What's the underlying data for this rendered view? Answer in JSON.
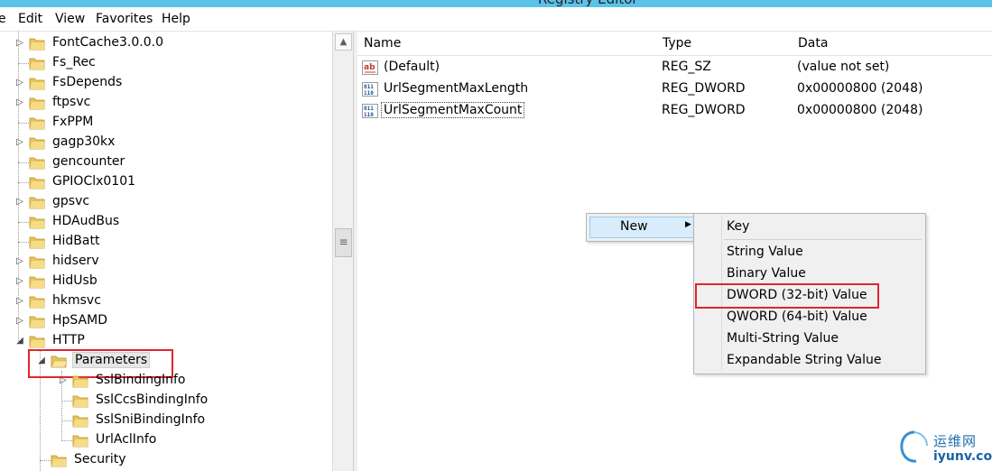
{
  "window": {
    "title": "Registry Editor"
  },
  "menu": [
    "e",
    "Edit",
    "View",
    "Favorites",
    "Help"
  ],
  "tree": {
    "items": [
      {
        "label": "FontCache3.0.0.0",
        "expander": "▷"
      },
      {
        "label": "Fs_Rec",
        "expander": ""
      },
      {
        "label": "FsDepends",
        "expander": "▷"
      },
      {
        "label": "ftpsvc",
        "expander": "▷"
      },
      {
        "label": "FxPPM",
        "expander": ""
      },
      {
        "label": "gagp30kx",
        "expander": "▷"
      },
      {
        "label": "gencounter",
        "expander": ""
      },
      {
        "label": "GPIOClx0101",
        "expander": ""
      },
      {
        "label": "gpsvc",
        "expander": "▷"
      },
      {
        "label": "HDAudBus",
        "expander": ""
      },
      {
        "label": "HidBatt",
        "expander": ""
      },
      {
        "label": "hidserv",
        "expander": "▷"
      },
      {
        "label": "HidUsb",
        "expander": "▷"
      },
      {
        "label": "hkmsvc",
        "expander": "▷"
      },
      {
        "label": "HpSAMD",
        "expander": "▷"
      },
      {
        "label": "HTTP",
        "expander": "◢"
      }
    ],
    "parameters": {
      "label": "Parameters",
      "expander": "◢"
    },
    "children": [
      {
        "label": "SslBindingInfo",
        "expander": "▷"
      },
      {
        "label": "SslCcsBindingInfo",
        "expander": ""
      },
      {
        "label": "SslSniBindingInfo",
        "expander": ""
      },
      {
        "label": "UrlAclInfo",
        "expander": ""
      }
    ],
    "security": {
      "label": "Security"
    }
  },
  "list": {
    "columns": [
      "Name",
      "Type",
      "Data"
    ],
    "rows": [
      {
        "name": "(Default)",
        "type": "REG_SZ",
        "data": "(value not set)",
        "icon": "string-value-icon"
      },
      {
        "name": "UrlSegmentMaxLength",
        "type": "REG_DWORD",
        "data": "0x00000800 (2048)",
        "icon": "binary-value-icon"
      },
      {
        "name": "UrlSegmentMaxCount",
        "type": "REG_DWORD",
        "data": "0x00000800 (2048)",
        "icon": "binary-value-icon"
      }
    ]
  },
  "context_menu": {
    "new_label": "New",
    "submenu": {
      "key": "Key",
      "items": [
        "String Value",
        "Binary Value",
        "DWORD (32-bit) Value",
        "QWORD (64-bit) Value",
        "Multi-String Value",
        "Expandable String Value"
      ],
      "highlighted": "DWORD (32-bit) Value"
    }
  },
  "watermark": {
    "cn": "运维网",
    "url": "iyunv.com"
  },
  "colors": {
    "titlebar": "#5bc2ea",
    "highlight": "#e0262b",
    "menu_hover": "#d9ecfb"
  }
}
